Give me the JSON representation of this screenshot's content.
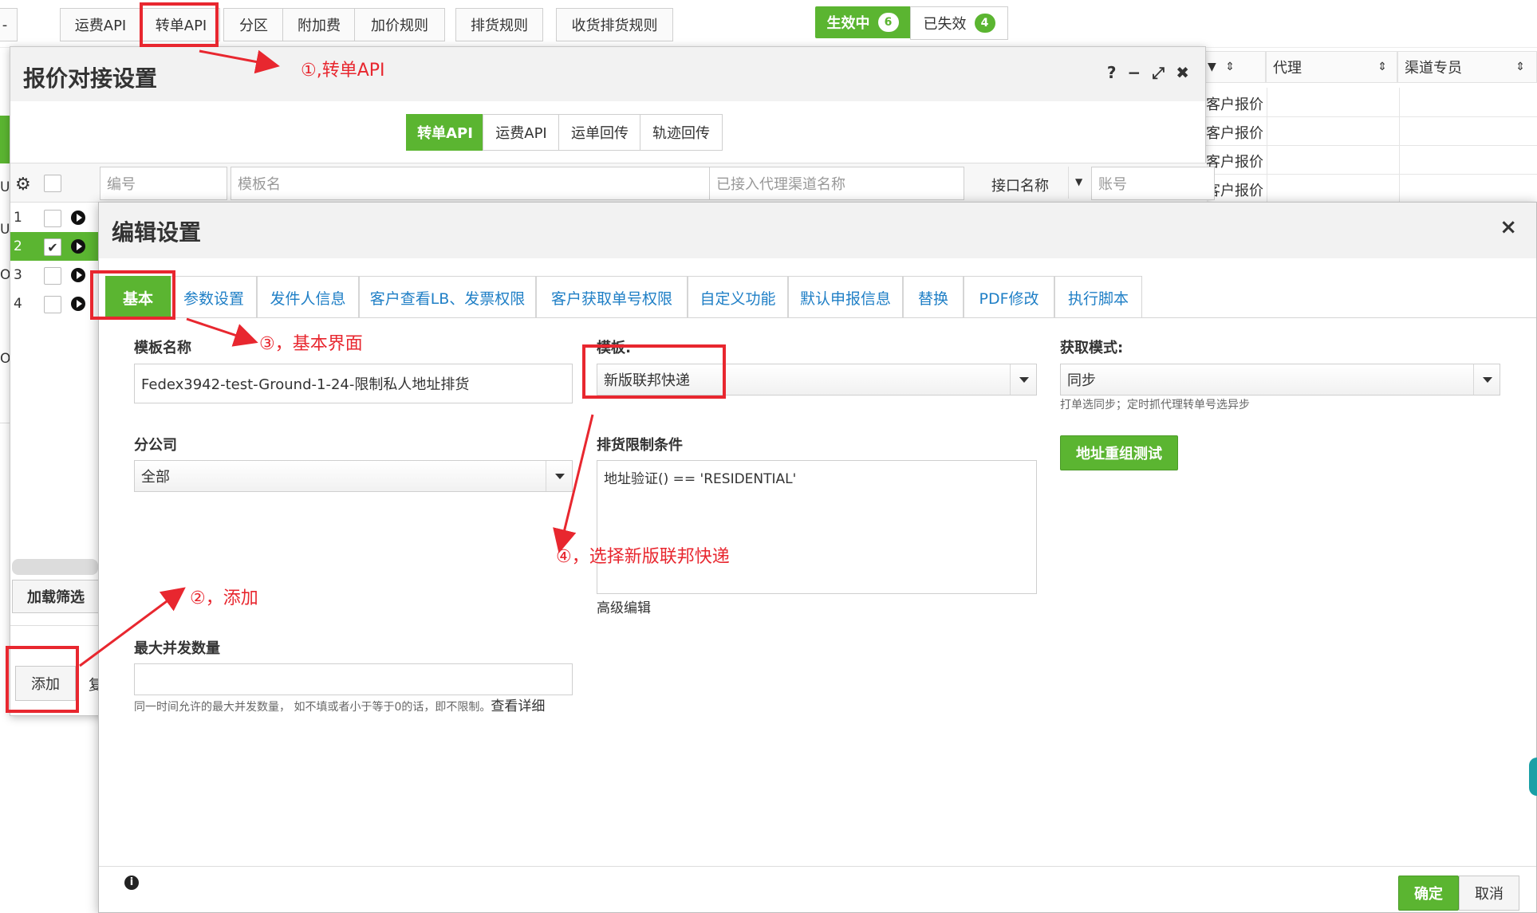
{
  "top_tabs": [
    "运费API",
    "转单API",
    "分区",
    "附加费",
    "加价规则",
    "排货规则",
    "收货排货规则"
  ],
  "status": {
    "active_label": "生效中",
    "active_count": "6",
    "inactive_label": "已失效",
    "inactive_count": "4"
  },
  "bg_table": {
    "headers": [
      "代理",
      "渠道专员"
    ],
    "rows": [
      "客户报价",
      "客户报价",
      "客户报价",
      "客户报价"
    ]
  },
  "left_panel": {
    "load_filter": "加载筛选",
    "add_label": "添加",
    "copy_fragment": "复",
    "row_labels": [
      "1",
      "2",
      "3",
      "4"
    ]
  },
  "dialog1": {
    "title": "报价对接设置",
    "controls": [
      "?",
      "−",
      "⤢",
      "✖"
    ],
    "tabs": [
      "转单API",
      "运费API",
      "运单回传",
      "轨迹回传"
    ],
    "filters": {
      "number_ph": "编号",
      "template_ph": "模板名",
      "channel_ph": "已接入代理渠道名称",
      "interface_label": "接口名称",
      "account_ph": "账号"
    }
  },
  "dialog2": {
    "title": "编辑设置",
    "close": "×",
    "tabs": [
      "基本",
      "参数设置",
      "发件人信息",
      "客户查看LB、发票权限",
      "客户获取单号权限",
      "自定义功能",
      "默认申报信息",
      "替换",
      "PDF修改",
      "执行脚本"
    ],
    "template_name_label": "模板名称",
    "template_name_value": "Fedex3942-test-Ground-1-24-限制私人地址排货",
    "template_label": "模板:",
    "template_value": "新版联邦快递",
    "mode_label": "获取模式:",
    "mode_value": "同步",
    "mode_hint": "打单选同步；定时抓代理转单号选异步",
    "branch_label": "分公司",
    "branch_value": "全部",
    "restrict_label": "排货限制条件",
    "restrict_value": "地址验证() == 'RESIDENTIAL'",
    "advanced_edit": "高级编辑",
    "address_test_btn": "地址重组测试",
    "max_concurrency_label": "最大并发数量",
    "max_concurrency_hint": "同一时间允许的最大并发数量， 如不填或者小于等于0的话，即不限制。",
    "view_detail": "查看详细",
    "ok_btn": "确定",
    "cancel_btn": "取消",
    "info_icon": "i"
  },
  "annotations": {
    "a1": "①,转单API",
    "a2": "②，添加",
    "a3": "③，基本界面",
    "a4": "④，选择新版联邦快递"
  },
  "colors": {
    "accent_green": "#5bb531",
    "annotation_red": "#e8272f",
    "link_blue": "#1f7fc6"
  }
}
